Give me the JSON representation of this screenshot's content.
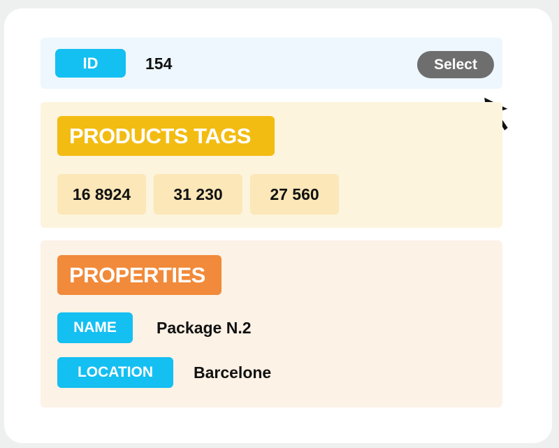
{
  "id_row": {
    "label": "ID",
    "value": "154",
    "select_label": "Select"
  },
  "products_tags": {
    "title": "PRODUCTS TAGS",
    "tags": [
      "16 8924",
      "31 230",
      "27 560"
    ]
  },
  "properties": {
    "title": "PROPERTIES",
    "items": [
      {
        "key": "NAME",
        "value": "Package N.2"
      },
      {
        "key": "LOCATION",
        "value": "Barcelone"
      }
    ]
  },
  "colors": {
    "accent_blue": "#14bff2",
    "tags_yellow": "#f2bc12",
    "properties_orange": "#f18a3a",
    "select_gray": "#6e6e6e"
  },
  "icons": {
    "cursor": "mouse-pointer-icon"
  }
}
